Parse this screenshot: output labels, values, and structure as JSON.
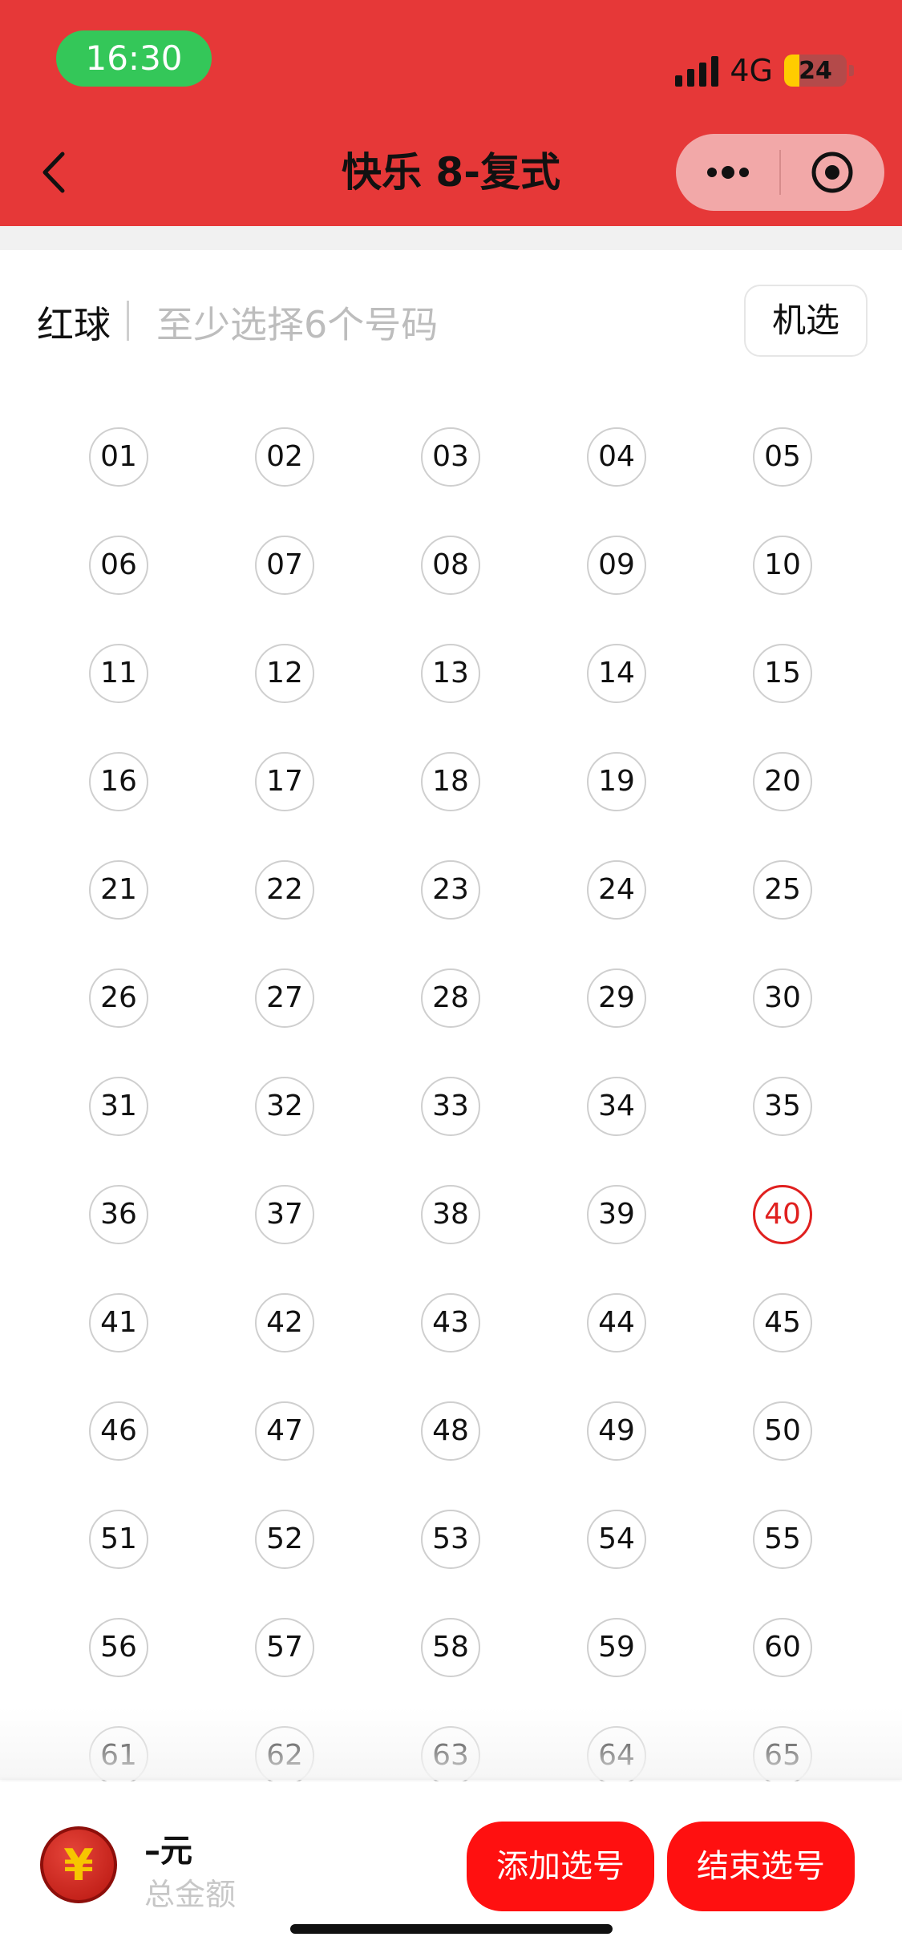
{
  "status": {
    "time": "16:30",
    "network": "4G",
    "battery": "24",
    "battery_level": 0.24
  },
  "nav": {
    "title": "快乐 8-复式",
    "back_icon": "chevron-left-icon",
    "more_icon": "more-dots-icon",
    "close_icon": "target-close-icon"
  },
  "section": {
    "title": "红球",
    "hint": "至少选择6个号码",
    "random_button": "机选"
  },
  "balls": [
    "01",
    "02",
    "03",
    "04",
    "05",
    "06",
    "07",
    "08",
    "09",
    "10",
    "11",
    "12",
    "13",
    "14",
    "15",
    "16",
    "17",
    "18",
    "19",
    "20",
    "21",
    "22",
    "23",
    "24",
    "25",
    "26",
    "27",
    "28",
    "29",
    "30",
    "31",
    "32",
    "33",
    "34",
    "35",
    "36",
    "37",
    "38",
    "39",
    "40",
    "41",
    "42",
    "43",
    "44",
    "45",
    "46",
    "47",
    "48",
    "49",
    "50",
    "51",
    "52",
    "53",
    "54",
    "55",
    "56",
    "57",
    "58",
    "59",
    "60",
    "61",
    "62",
    "63",
    "64",
    "65"
  ],
  "selected_balls": [
    "40"
  ],
  "colors": {
    "header": "#e63838",
    "accent": "#ff1010",
    "selected": "#e0201f"
  },
  "footer": {
    "coin_symbol": "¥",
    "amount": "–元",
    "amount_label": "总金额",
    "add_button": "添加选号",
    "end_button": "结束选号"
  }
}
